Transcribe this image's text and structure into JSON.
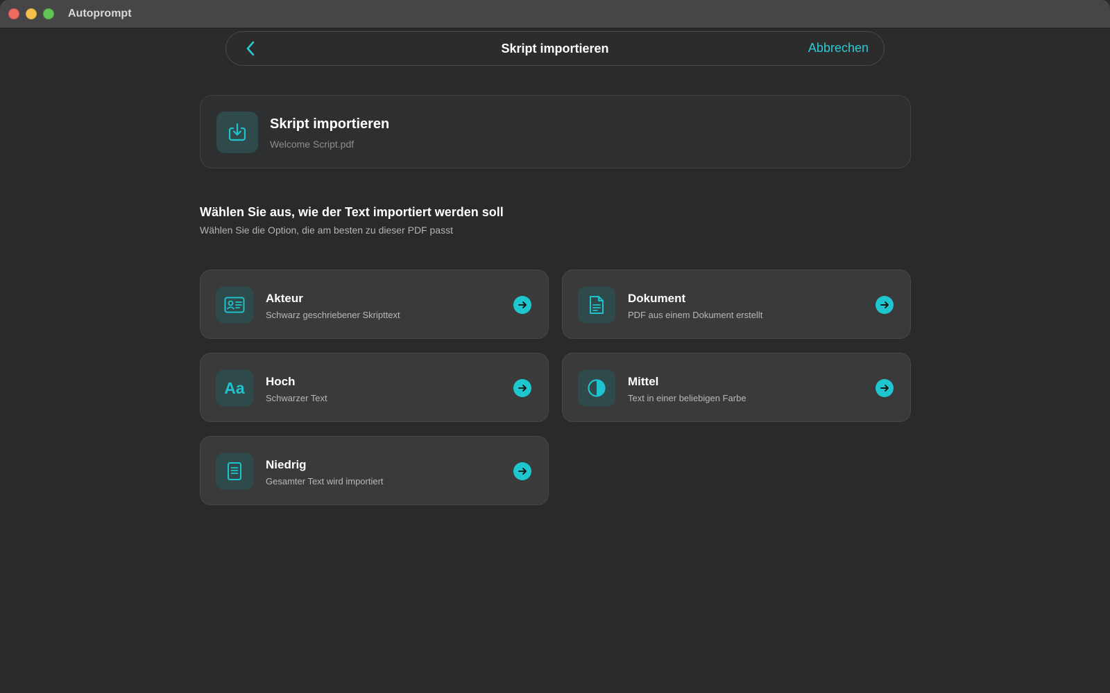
{
  "window": {
    "title": "Autoprompt"
  },
  "nav": {
    "title": "Skript importieren",
    "cancel_label": "Abbrechen",
    "back_icon": "chevron-left-icon"
  },
  "import": {
    "title": "Skript importieren",
    "filename": "Welcome Script.pdf",
    "icon": "import-download-icon"
  },
  "section": {
    "title": "Wählen Sie aus, wie der Text importiert werden soll",
    "subtitle": "Wählen Sie die Option, die am besten zu dieser PDF passt"
  },
  "options": [
    {
      "title": "Akteur",
      "description": "Schwarz geschriebener Skripttext",
      "icon": "id-card-icon"
    },
    {
      "title": "Dokument",
      "description": "PDF aus einem Dokument erstellt",
      "icon": "document-icon"
    },
    {
      "title": "Hoch",
      "description": "Schwarzer Text",
      "icon": "text-format-icon",
      "glyph": "Aa"
    },
    {
      "title": "Mittel",
      "description": "Text in einer beliebigen Farbe",
      "icon": "contrast-icon"
    },
    {
      "title": "Niedrig",
      "description": "Gesamter Text wird importiert",
      "icon": "page-lines-icon"
    }
  ],
  "colors": {
    "accent": "#20c3cd",
    "background": "#2a2a2a",
    "card": "#3a3a3a",
    "icon_box": "#2f4a4b"
  }
}
